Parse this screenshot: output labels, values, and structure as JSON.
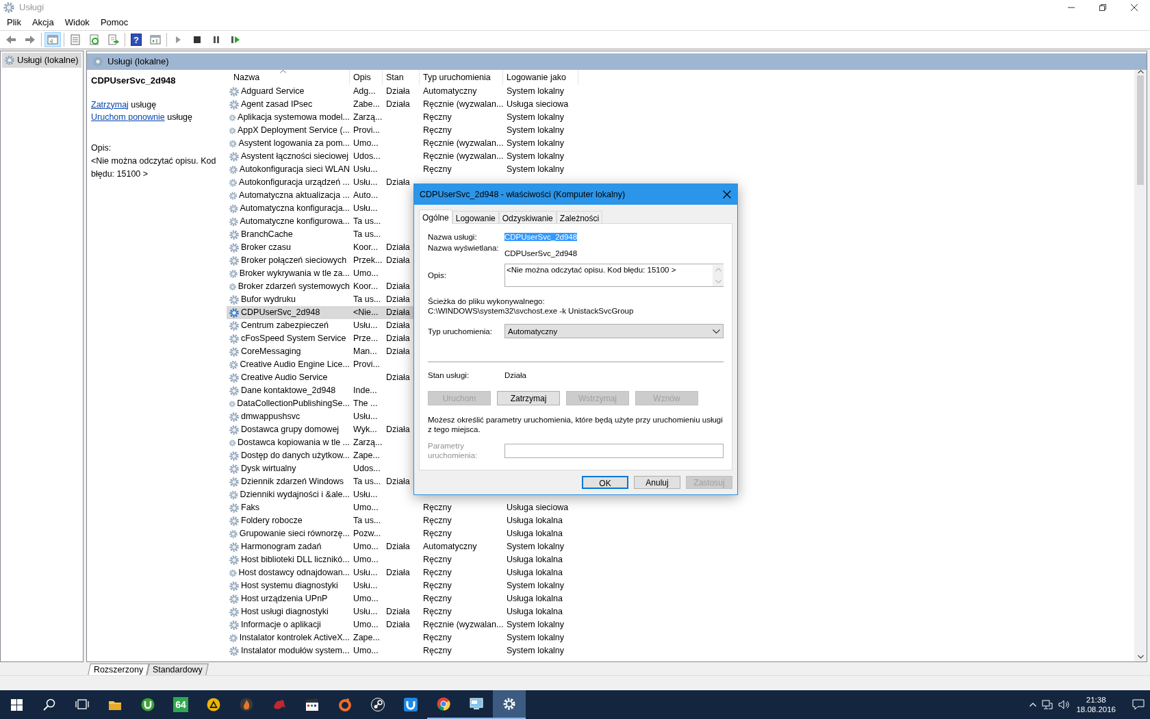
{
  "window": {
    "title": "Usługi"
  },
  "menu": [
    "Plik",
    "Akcja",
    "Widok",
    "Pomoc"
  ],
  "toolbar": [
    {
      "kind": "back",
      "on": false
    },
    {
      "kind": "forward",
      "on": false
    },
    {
      "kind": "tree",
      "on": true
    },
    {
      "kind": "properties",
      "on": false
    },
    {
      "kind": "refresh",
      "on": false
    },
    {
      "kind": "export",
      "on": false
    },
    {
      "kind": "help",
      "label": "?",
      "on": false
    },
    {
      "kind": "pane",
      "on": false
    },
    {
      "kind": "play",
      "on": false
    },
    {
      "kind": "stop",
      "on": false
    },
    {
      "kind": "pause",
      "on": false
    },
    {
      "kind": "resume",
      "on": false
    }
  ],
  "tree": [
    {
      "label": "Usługi (lokalne)",
      "selected": true
    }
  ],
  "pane_header": "Usługi (lokalne)",
  "details": {
    "title": "CDPUserSvc_2d948",
    "actions": [
      {
        "link": "Zatrzymaj",
        "text": "usługę"
      },
      {
        "link": "Uruchom ponownie",
        "text": "usługę"
      }
    ],
    "description_label": "Opis:",
    "description": "<Nie można odczytać opisu. Kod błędu: 15100 >"
  },
  "table": {
    "columns": [
      {
        "label": "Nazwa",
        "sorted": true
      },
      {
        "label": "Opis",
        "sorted": false
      },
      {
        "label": "Stan",
        "sorted": false
      },
      {
        "label": "Typ uruchomienia",
        "sorted": false
      },
      {
        "label": "Logowanie jako",
        "sorted": false
      }
    ],
    "rows": [
      {
        "name": "Adguard Service",
        "description": "Adg...",
        "status": "Działa",
        "startup": "Automatyczny",
        "logon": "System lokalny",
        "selected": false
      },
      {
        "name": "Agent zasad IPsec",
        "description": "Zabe...",
        "status": "Działa",
        "startup": "Ręcznie (wyzwalan...",
        "logon": "Usługa sieciowa",
        "selected": false
      },
      {
        "name": "Aplikacja systemowa model...",
        "description": "Zarzą...",
        "startup": "Ręczny",
        "logon": "System lokalny",
        "selected": false
      },
      {
        "name": "AppX Deployment Service (...",
        "description": "Provi...",
        "startup": "Ręczny",
        "logon": "System lokalny",
        "selected": false
      },
      {
        "name": "Asystent logowania za pom...",
        "description": "Umo...",
        "startup": "Ręcznie (wyzwalan...",
        "logon": "System lokalny",
        "selected": false
      },
      {
        "name": "Asystent łączności sieciowej",
        "description": "Udos...",
        "startup": "Ręcznie (wyzwalan...",
        "logon": "System lokalny",
        "selected": false
      },
      {
        "name": "Autokonfiguracja sieci WLAN",
        "description": "Usłu...",
        "startup": "Ręczny",
        "logon": "System lokalny",
        "selected": false
      },
      {
        "name": "Autokonfiguracja urządzeń ...",
        "description": "Usłu...",
        "status": "Działa",
        "selected": false
      },
      {
        "name": "Automatyczna aktualizacja ...",
        "description": "Auto...",
        "selected": false
      },
      {
        "name": "Automatyczna konfiguracja...",
        "description": "Usłu...",
        "selected": false
      },
      {
        "name": "Automatyczne konfigurowa...",
        "description": "Ta us...",
        "selected": false
      },
      {
        "name": "BranchCache",
        "description": "Ta us...",
        "selected": false
      },
      {
        "name": "Broker czasu",
        "description": "Koor...",
        "status": "Działa",
        "selected": false
      },
      {
        "name": "Broker połączeń sieciowych",
        "description": "Przek...",
        "status": "Działa",
        "selected": false
      },
      {
        "name": "Broker wykrywania w tle za...",
        "description": "Umo...",
        "selected": false
      },
      {
        "name": "Broker zdarzeń systemowych",
        "description": "Koor...",
        "status": "Działa",
        "selected": false
      },
      {
        "name": "Bufor wydruku",
        "description": "Ta us...",
        "status": "Działa",
        "selected": false
      },
      {
        "name": "CDPUserSvc_2d948",
        "description": "<Nie...",
        "status": "Działa",
        "selected": true
      },
      {
        "name": "Centrum zabezpieczeń",
        "description": "Usłu...",
        "status": "Działa",
        "selected": false
      },
      {
        "name": "cFosSpeed System Service",
        "description": "Prze...",
        "status": "Działa",
        "selected": false
      },
      {
        "name": "CoreMessaging",
        "description": "Man...",
        "status": "Działa",
        "selected": false
      },
      {
        "name": "Creative Audio Engine Lice...",
        "description": "Provi...",
        "selected": false
      },
      {
        "name": "Creative Audio Service",
        "status": "Działa",
        "selected": false
      },
      {
        "name": "Dane kontaktowe_2d948",
        "description": "Inde...",
        "selected": false
      },
      {
        "name": "DataCollectionPublishingSe...",
        "description": "The ...",
        "selected": false
      },
      {
        "name": "dmwappushsvc",
        "description": "Usłu...",
        "selected": false
      },
      {
        "name": "Dostawca grupy domowej",
        "description": "Wyk...",
        "status": "Działa",
        "selected": false
      },
      {
        "name": "Dostawca kopiowania w tle ...",
        "description": "Zarzą...",
        "selected": false
      },
      {
        "name": "Dostęp do danych użytkow...",
        "description": "Zape...",
        "selected": false
      },
      {
        "name": "Dysk wirtualny",
        "description": "Udos...",
        "selected": false
      },
      {
        "name": "Dziennik zdarzeń Windows",
        "description": "Ta us...",
        "status": "Działa",
        "selected": false
      },
      {
        "name": "Dzienniki wydajności i &ale...",
        "description": "Usłu...",
        "selected": false
      },
      {
        "name": "Faks",
        "description": "Umo...",
        "startup": "Ręczny",
        "logon": "Usługa sieciowa",
        "selected": false
      },
      {
        "name": "Foldery robocze",
        "description": "Ta us...",
        "startup": "Ręczny",
        "logon": "Usługa lokalna",
        "selected": false
      },
      {
        "name": "Grupowanie sieci równorzę...",
        "description": "Pozw...",
        "startup": "Ręczny",
        "logon": "Usługa lokalna",
        "selected": false
      },
      {
        "name": "Harmonogram zadań",
        "description": "Umo...",
        "status": "Działa",
        "startup": "Automatyczny",
        "logon": "System lokalny",
        "selected": false
      },
      {
        "name": "Host biblioteki DLL licznikó...",
        "description": "Umo...",
        "startup": "Ręczny",
        "logon": "Usługa lokalna",
        "selected": false
      },
      {
        "name": "Host dostawcy odnajdowan...",
        "description": "Usłu...",
        "status": "Działa",
        "startup": "Ręczny",
        "logon": "Usługa lokalna",
        "selected": false
      },
      {
        "name": "Host systemu diagnostyki",
        "description": "Usłu...",
        "startup": "Ręczny",
        "logon": "System lokalny",
        "selected": false
      },
      {
        "name": "Host urządzenia UPnP",
        "description": "Umo...",
        "startup": "Ręczny",
        "logon": "Usługa lokalna",
        "selected": false
      },
      {
        "name": "Host usługi diagnostyki",
        "description": "Usłu...",
        "status": "Działa",
        "startup": "Ręczny",
        "logon": "Usługa lokalna",
        "selected": false
      },
      {
        "name": "Informacje o aplikacji",
        "description": "Umo...",
        "status": "Działa",
        "startup": "Ręcznie (wyzwalan...",
        "logon": "System lokalny",
        "selected": false
      },
      {
        "name": "Instalator kontrolek ActiveX...",
        "description": "Zape...",
        "startup": "Ręczny",
        "logon": "System lokalny",
        "selected": false
      },
      {
        "name": "Instalator modułów system...",
        "description": "Umo...",
        "startup": "Ręczny",
        "logon": "System lokalny",
        "selected": false
      }
    ]
  },
  "view_tabs": [
    {
      "label": "Rozszerzony",
      "selected": true
    },
    {
      "label": "Standardowy",
      "selected": false
    }
  ],
  "dialog": {
    "title": "CDPUserSvc_2d948 - właściwości (Komputer lokalny)",
    "tabs": [
      {
        "label": "Ogólne",
        "selected": true
      },
      {
        "label": "Logowanie",
        "selected": false
      },
      {
        "label": "Odzyskiwanie",
        "selected": false
      },
      {
        "label": "Zależności",
        "selected": false
      }
    ],
    "service_name_label": "Nazwa usługi:",
    "service_name": {
      "value": "CDPUserSvc_2d948",
      "highlighted": true
    },
    "display_name_label": "Nazwa wyświetlana:",
    "display_name": "CDPUserSvc_2d948",
    "description_label": "Opis:",
    "description": "<Nie można odczytać opisu. Kod błędu: 15100 >",
    "path_label": "Ścieżka do pliku wykonywalnego:",
    "path": "C:\\WINDOWS\\system32\\svchost.exe -k UnistackSvcGroup",
    "startup_label": "Typ uruchomienia:",
    "startup_type": "Automatyczny",
    "status_label": "Stan usługi:",
    "status": "Działa",
    "service_buttons": [
      {
        "label": "Uruchom",
        "disabled": true
      },
      {
        "label": "Zatrzymaj",
        "disabled": false
      },
      {
        "label": "Wstrzymaj",
        "disabled": true
      },
      {
        "label": "Wznów",
        "disabled": true
      }
    ],
    "hint": "Możesz określić parametry uruchomienia, które będą użyte przy uruchomieniu usługi z tego miejsca.",
    "parameters": {
      "label": "Parametry uruchomienia:",
      "disabled": true
    },
    "buttons": [
      {
        "label": "OK",
        "default": true,
        "disabled": false
      },
      {
        "label": "Anuluj",
        "default": false,
        "disabled": false
      },
      {
        "label": "Zastosuj",
        "default": false,
        "disabled": true
      }
    ]
  },
  "taskbar": {
    "apps": [
      {
        "kind": "folder",
        "running": false,
        "active": false
      },
      {
        "kind": "torrent",
        "running": false,
        "active": false
      },
      {
        "kind": "badge64",
        "label": "64",
        "running": false,
        "active": false
      },
      {
        "kind": "triangle",
        "running": false,
        "active": false
      },
      {
        "kind": "flame",
        "running": false,
        "active": false
      },
      {
        "kind": "creature",
        "running": false,
        "active": false
      },
      {
        "kind": "clapper",
        "running": false,
        "active": false
      },
      {
        "kind": "ring",
        "running": false,
        "active": false
      },
      {
        "kind": "steam",
        "running": false,
        "active": false
      },
      {
        "kind": "cup",
        "running": false,
        "active": false
      },
      {
        "kind": "chrome",
        "running": true,
        "active": false
      },
      {
        "kind": "monitor",
        "running": true,
        "active": false
      },
      {
        "kind": "gear",
        "running": true,
        "active": true
      }
    ],
    "time": "21:38",
    "date": "18.08.2016"
  }
}
